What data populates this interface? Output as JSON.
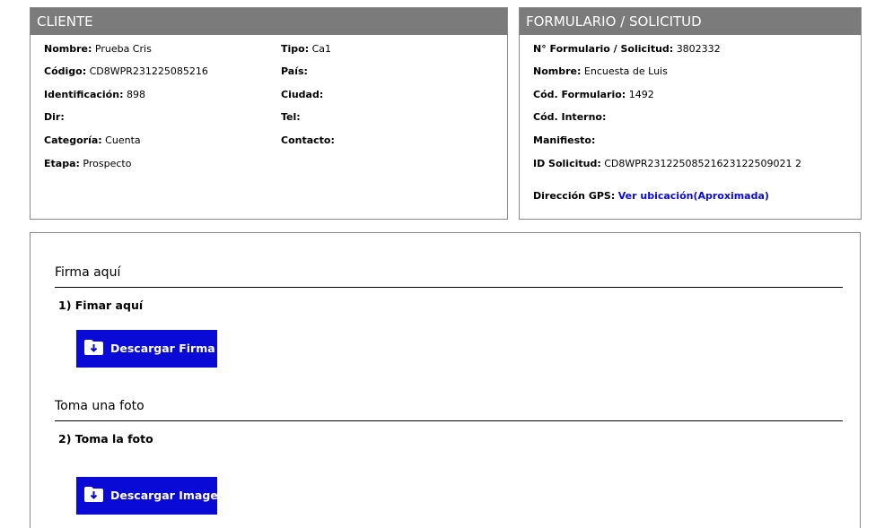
{
  "client": {
    "header": "CLIENTE",
    "left": [
      {
        "label": "Nombre:",
        "value": "Prueba Cris"
      },
      {
        "label": "Código:",
        "value": "CD8WPR231225085216"
      },
      {
        "label": "Identificación:",
        "value": "898"
      },
      {
        "label": "Dir:",
        "value": ""
      },
      {
        "label": "Categoría:",
        "value": "Cuenta"
      },
      {
        "label": "Etapa:",
        "value": "Prospecto"
      }
    ],
    "right": [
      {
        "label": "Tipo:",
        "value": "Ca1"
      },
      {
        "label": "País:",
        "value": ""
      },
      {
        "label": "Ciudad:",
        "value": ""
      },
      {
        "label": "Tel:",
        "value": ""
      },
      {
        "label": "Contacto:",
        "value": ""
      }
    ]
  },
  "form": {
    "header": "FORMULARIO / SOLICITUD",
    "fields": [
      {
        "label": "N° Formulario / Solicitud:",
        "value": "3802332"
      },
      {
        "label": "Nombre:",
        "value": "Encuesta de Luis"
      },
      {
        "label": "Cód. Formulario:",
        "value": "1492"
      },
      {
        "label": "Cód. Interno:",
        "value": ""
      },
      {
        "label": "Manifiesto:",
        "value": ""
      },
      {
        "label": "ID Solicitud:",
        "value": "CD8WPR23122508521623122509021 2"
      }
    ],
    "gps_label": "Dirección GPS:",
    "gps_link": "Ver ubicación(Aproximada)"
  },
  "sections": [
    {
      "title": "Firma aquí",
      "question": "1) Fimar aquí",
      "button": "Descargar Firma"
    },
    {
      "title": "Toma una foto",
      "question": "2) Toma la foto",
      "button": "Descargar Imagen"
    }
  ],
  "icons": {
    "download": "folder-download-icon"
  },
  "colors": {
    "header_bg": "#7b7b7b",
    "button_bg": "#0a0ad6",
    "link": "#0a0ad6"
  }
}
